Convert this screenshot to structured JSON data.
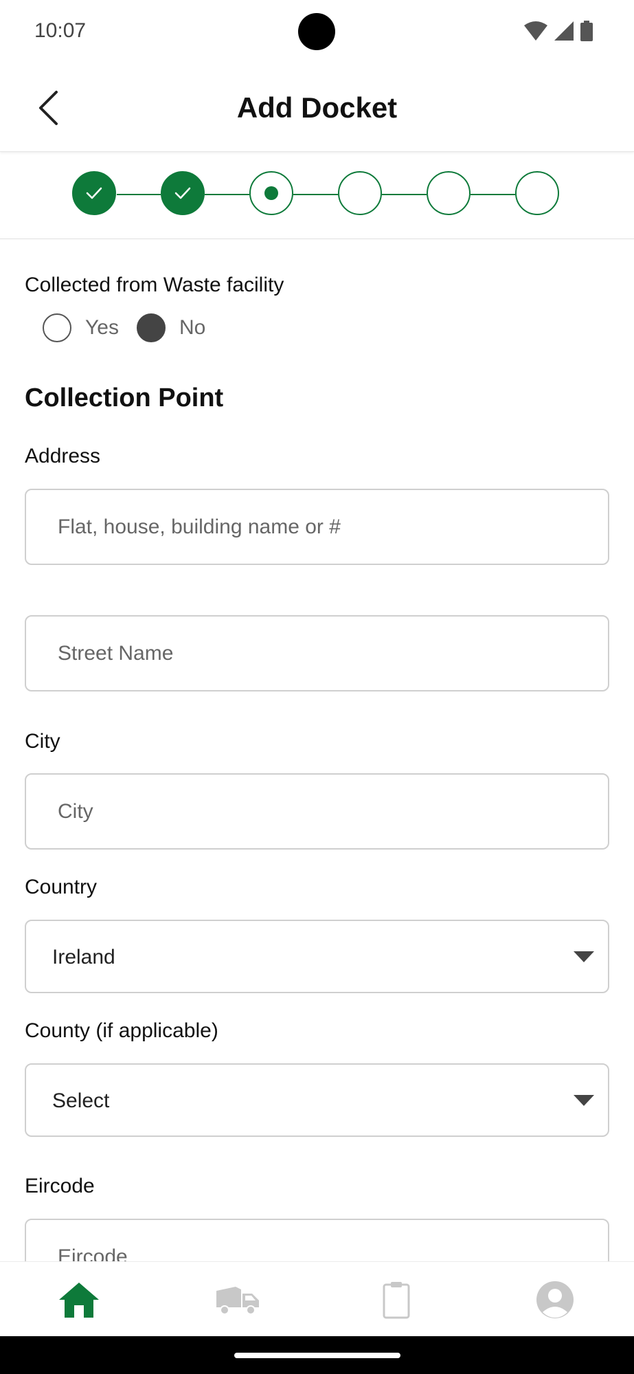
{
  "status_bar": {
    "time": "10:07"
  },
  "app_bar": {
    "title": "Add Docket"
  },
  "stepper": {
    "total_steps": 6,
    "completed_steps": 2,
    "current_step": 3
  },
  "form": {
    "waste_facility": {
      "label": "Collected from Waste facility",
      "options": [
        "Yes",
        "No"
      ],
      "selected": "No"
    },
    "section_title": "Collection Point",
    "address_label": "Address",
    "address_line1_placeholder": "Flat, house, building name or #",
    "street_placeholder": "Street Name",
    "city_label": "City",
    "city_placeholder": "City",
    "country_label": "Country",
    "country_value": "Ireland",
    "county_label": "County (if applicable)",
    "county_value": "Select",
    "eircode_label": "Eircode",
    "eircode_placeholder": "Eircode"
  },
  "bottom_nav": {
    "items": [
      {
        "icon": "home-icon",
        "active": true
      },
      {
        "icon": "truck-icon",
        "active": false
      },
      {
        "icon": "clipboard-icon",
        "active": false
      },
      {
        "icon": "profile-icon",
        "active": false
      }
    ]
  },
  "colors": {
    "accent": "#0e7a3a",
    "inactive_icon": "#c8c8c8"
  }
}
